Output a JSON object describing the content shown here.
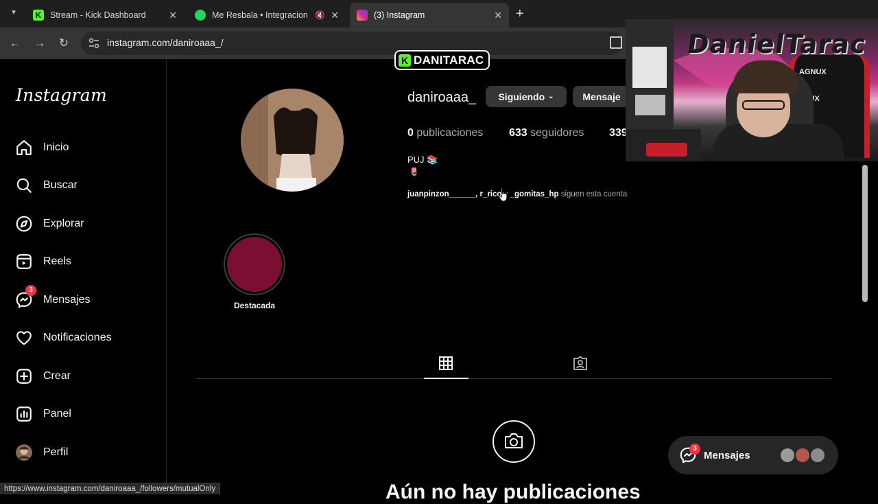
{
  "browser": {
    "tabs": [
      {
        "title": "Stream - Kick Dashboard",
        "favicon_color": "#53fc18"
      },
      {
        "title": "Me Resbala • Integracion C",
        "favicon_color": "#1ed760"
      },
      {
        "title": "(3) Instagram",
        "favicon_color": "#d6249f"
      }
    ],
    "new_tab": "+",
    "url": "instagram.com/daniroaaa_/",
    "status_url": "https://www.instagram.com/daniroaaa_/followers/mutualOnly"
  },
  "sidebar": {
    "logo": "Instagram",
    "items": [
      {
        "label": "Inicio",
        "icon": "home-icon"
      },
      {
        "label": "Buscar",
        "icon": "search-icon"
      },
      {
        "label": "Explorar",
        "icon": "compass-icon"
      },
      {
        "label": "Reels",
        "icon": "reels-icon"
      },
      {
        "label": "Mensajes",
        "icon": "messenger-icon",
        "badge": "3"
      },
      {
        "label": "Notificaciones",
        "icon": "heart-icon"
      },
      {
        "label": "Crear",
        "icon": "plus-square-icon"
      },
      {
        "label": "Panel",
        "icon": "chart-icon"
      },
      {
        "label": "Perfil",
        "icon": "avatar-icon"
      }
    ]
  },
  "profile": {
    "username": "daniroaaa_",
    "following_button": "Siguiendo",
    "message_button": "Mensaje",
    "posts_count": "0",
    "posts_label": "publicaciones",
    "followers_count": "633",
    "followers_label": "seguidores",
    "following_partial": "339",
    "bio_line1": "PUJ 📚",
    "bio_line2": "🌷",
    "mutuals": {
      "names": "juanpinzon______, r_rico",
      "and": " y ",
      "last": "_gomitas_hp",
      "suffix": " siguen esta cuenta"
    },
    "highlight_label": "Destacada",
    "no_posts": "Aún no hay publicaciones"
  },
  "messages_float": {
    "label": "Mensajes",
    "badge": "3"
  },
  "overlay": {
    "streamer_tag": "DANITARAC",
    "graffiti": "DanielTarac",
    "chair_brand": "AGNUX",
    "chair_brand2": "GNUX"
  },
  "colors": {
    "kick_green": "#53fc18",
    "badge_red": "#ff3040",
    "highlight": "#7a0f33"
  }
}
